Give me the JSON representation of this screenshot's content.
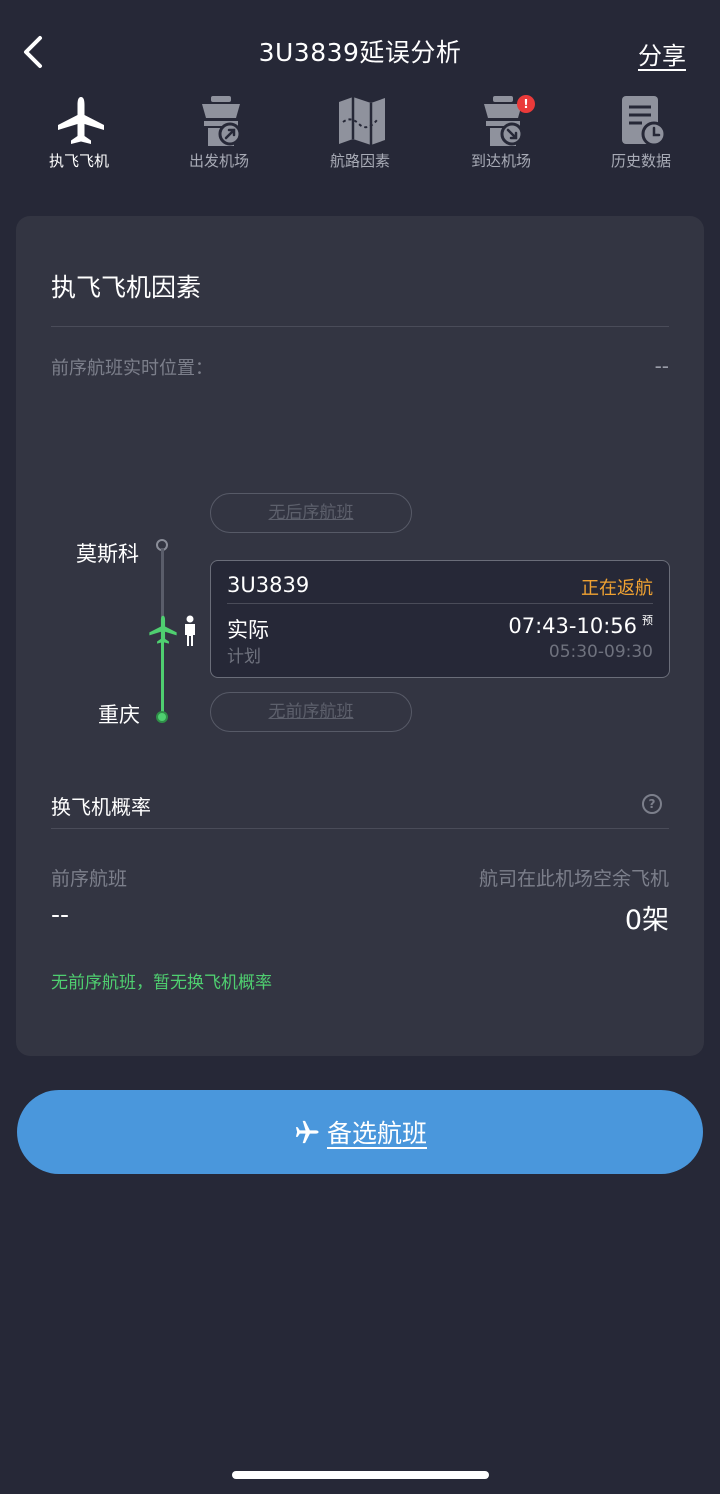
{
  "header": {
    "title": "3U3839延误分析",
    "share_label": "分享"
  },
  "tabs": [
    {
      "label": "执飞飞机",
      "icon": "airplane-icon",
      "active": true
    },
    {
      "label": "出发机场",
      "icon": "departure-tower-icon"
    },
    {
      "label": "航路因素",
      "icon": "map-icon"
    },
    {
      "label": "到达机场",
      "icon": "arrival-tower-icon",
      "badge": "!"
    },
    {
      "label": "历史数据",
      "icon": "history-document-icon"
    }
  ],
  "aircraft": {
    "section_title": "执飞飞机因素",
    "prev_position_label": "前序航班实时位置：",
    "prev_position_value": "--",
    "next_flight_pill": "无后序航班",
    "prev_flight_pill": "无前序航班",
    "from_city": "莫斯科",
    "to_city": "重庆",
    "flight": {
      "number": "3U3839",
      "status": "正在返航",
      "actual_label": "实际",
      "actual_time": "07:43-10:56",
      "estimate_mark": "预",
      "plan_label": "计划",
      "plan_time": "05:30-09:30"
    }
  },
  "swap": {
    "title": "换飞机概率",
    "prev_flight_label": "前序航班",
    "prev_flight_value": "--",
    "spare_label": "航司在此机场空余飞机",
    "spare_value": "0架",
    "note": "无前序航班，暂无换飞机概率"
  },
  "alt_button": {
    "label": "备选航班"
  },
  "colors": {
    "background": "#262837",
    "card": "#333542",
    "accent_blue": "#4a97dc",
    "status_orange": "#f0a232",
    "green": "#4fcf70",
    "alert_red": "#ea3a3a"
  }
}
